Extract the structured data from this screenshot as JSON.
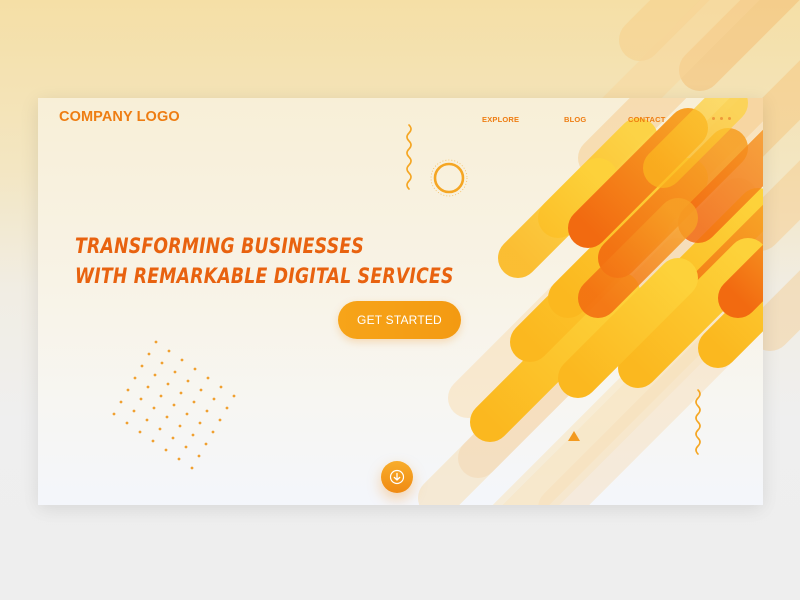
{
  "brand": {
    "logo_text": "COMPANY LOGO"
  },
  "nav": {
    "items": [
      {
        "label": "EXPLORE"
      },
      {
        "label": "BLOG"
      },
      {
        "label": "CONTACT"
      }
    ],
    "more_icon": "more-dots-icon"
  },
  "hero": {
    "headline_line1": "Transforming businesses",
    "headline_line2": "with remarkable digital services",
    "cta_label": "GET STARTED",
    "scroll_icon": "arrow-down-icon"
  },
  "colors": {
    "accent": "#ee7d12",
    "button": "#f7a419",
    "headline": "#e8620f"
  }
}
